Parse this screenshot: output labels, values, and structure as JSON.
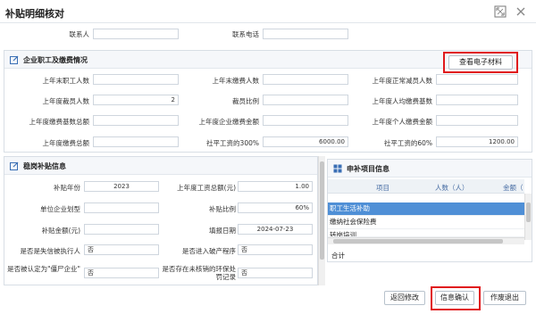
{
  "window": {
    "title": "补贴明细核对"
  },
  "contact": {
    "person_label": "联系人",
    "person_value": "",
    "phone_label": "联系电话",
    "phone_value": ""
  },
  "staff_section": {
    "title": "企业职工及缴费情况",
    "view_button": "查看电子材料",
    "rows": [
      [
        {
          "label": "上年末职工人数",
          "value": ""
        },
        {
          "label": "上年末缴费人数",
          "value": ""
        },
        {
          "label": "上年度正常减员人数",
          "value": ""
        }
      ],
      [
        {
          "label": "上年度裁员人数",
          "value": "2"
        },
        {
          "label": "裁员比例",
          "value": ""
        },
        {
          "label": "上年度人均缴费基数",
          "value": ""
        }
      ],
      [
        {
          "label": "上年度缴费基数总额",
          "value": ""
        },
        {
          "label": "上年度企业缴费金额",
          "value": ""
        },
        {
          "label": "上年度个人缴费金额",
          "value": ""
        }
      ],
      [
        {
          "label": "上年度缴费总额",
          "value": ""
        },
        {
          "label": "社平工资的300%",
          "value": "6000.00"
        },
        {
          "label": "社平工资的60%",
          "value": "1200.00"
        }
      ]
    ]
  },
  "subsidy_section": {
    "title": "稳岗补贴信息",
    "rows": [
      [
        {
          "label": "补贴年份",
          "value": "2023"
        },
        {
          "label": "上年度工资总额(元)",
          "value": "1.00"
        }
      ],
      [
        {
          "label": "单位企业划型",
          "value": ""
        },
        {
          "label": "补贴比例",
          "value": "60%"
        }
      ],
      [
        {
          "label": "补贴金额(元)",
          "value": ""
        },
        {
          "label": "填报日期",
          "value": "2024-07-23"
        }
      ],
      [
        {
          "label": "是否是失信被执行人",
          "value": "否"
        },
        {
          "label": "是否进入破产程序",
          "value": "否"
        }
      ],
      [
        {
          "label": "是否被认定为\"僵尸企业\"",
          "value": "否"
        },
        {
          "label": "是否存在未核销的环保处罚记录",
          "value": "否"
        }
      ]
    ]
  },
  "items_section": {
    "title": "申补项目信息",
    "columns": [
      "项目",
      "人数（人）",
      "金额（"
    ],
    "rows": [
      "职工生活补助",
      "缴纳社会保险费",
      "转岗培训"
    ],
    "total_label": "合计"
  },
  "footer": {
    "back_button": "返回修改",
    "confirm_button": "信息确认",
    "void_button": "作废退出"
  }
}
